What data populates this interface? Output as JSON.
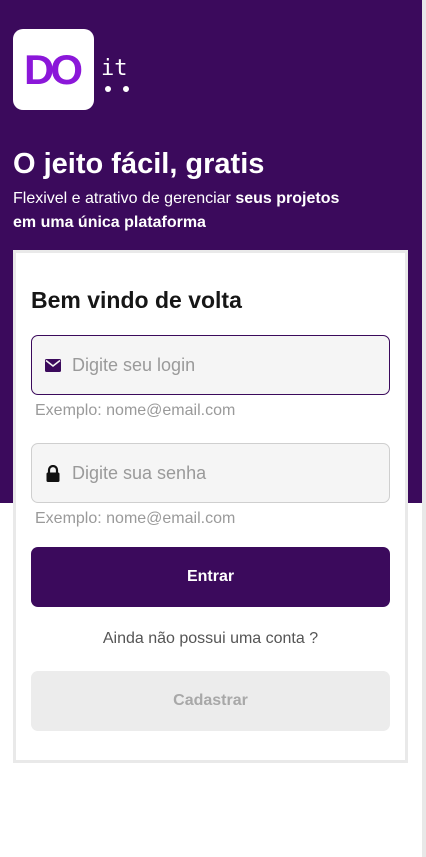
{
  "brand": {
    "logo_text": "DO",
    "logo_suffix": "it",
    "accent_color": "#3b0a5c",
    "logo_color": "#8b17d9"
  },
  "hero": {
    "headline": "O jeito fácil, gratis",
    "subtitle_regular": "Flexivel e atrativo de gerenciar ",
    "subtitle_bold": "seus projetos em uma única plataforma"
  },
  "login_card": {
    "title": "Bem vindo de volta",
    "login_field": {
      "icon": "envelope-icon",
      "placeholder": "Digite seu login",
      "value": "",
      "hint": "Exemplo: nome@email.com"
    },
    "password_field": {
      "icon": "lock-icon",
      "placeholder": "Digite sua senha",
      "value": "",
      "hint": "Exemplo: nome@email.com"
    },
    "submit_label": "Entrar",
    "signup_prompt": "Ainda não possui uma conta ?",
    "signup_label": "Cadastrar"
  }
}
